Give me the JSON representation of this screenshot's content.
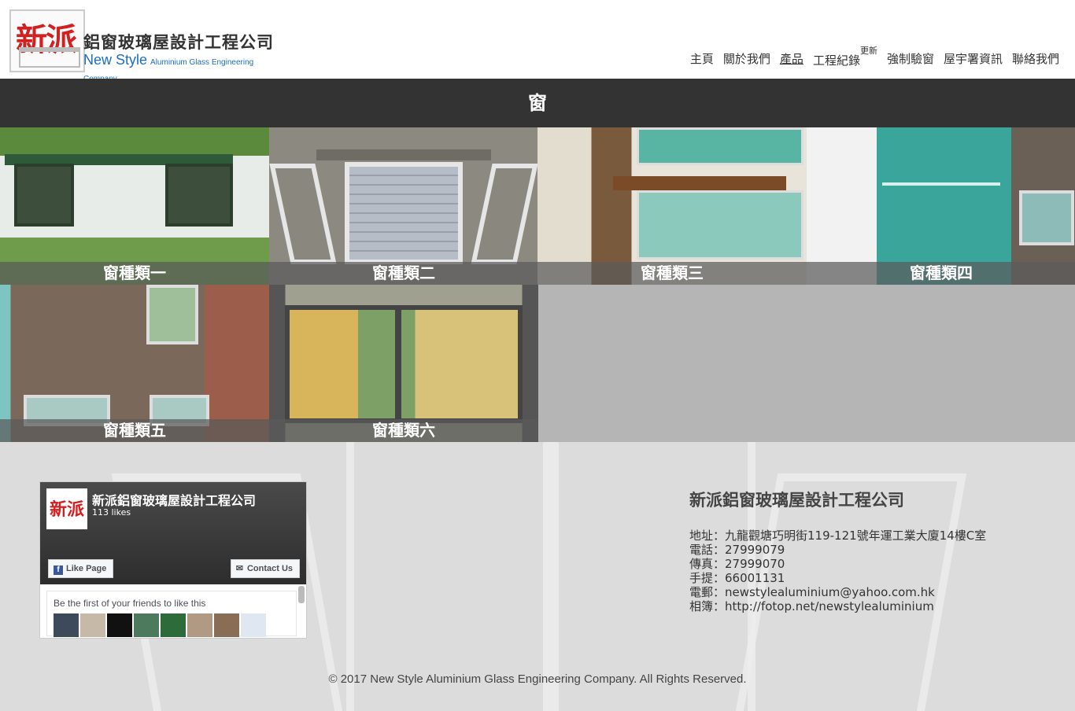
{
  "header": {
    "logo_glyph": "新派",
    "logo_title": "鋁窗玻璃屋設計工程公司",
    "logo_en": "New Style",
    "logo_en_sub": "Aluminium Glass Engineering Company"
  },
  "nav": {
    "items": [
      "主頁",
      "關於我們",
      "產品",
      "工程紀錄",
      "強制驗窗",
      "屋宇署資訊",
      "聯絡我們"
    ],
    "update_badge": "更新",
    "active": "產品"
  },
  "page_title": "窗",
  "tiles": [
    "窗種類一",
    "窗種類二",
    "窗種類三",
    "窗種類四",
    "窗種類五",
    "窗種類六"
  ],
  "facebook": {
    "page_name": "新派鋁窗玻璃屋設計工程公司",
    "likes": "113 likes",
    "avatar_glyph": "新派",
    "like_label": "Like Page",
    "contact_label": "Contact Us",
    "friends_text": "Be the first of your friends to like this"
  },
  "company": {
    "name": "新派鋁窗玻璃屋設計工程公司",
    "address": "地址：九龍觀塘巧明街119-121號年運工業大廈14樓C室",
    "phone": "電話：27999079",
    "fax": "傳真：27999070",
    "mobile": "手提：66001131",
    "email": "電郵：newstylealuminium@yahoo.com.hk",
    "album": "相簿：http://fotop.net/newstylealuminium"
  },
  "copyright": "© 2017 New Style Aluminium Glass Engineering Company. All Rights Reserved.",
  "colors": {
    "title_bar": "#333333",
    "logo_red": "#d21f1f",
    "logo_blue": "#1a6fc1",
    "facebook_blue": "#3b5998"
  }
}
